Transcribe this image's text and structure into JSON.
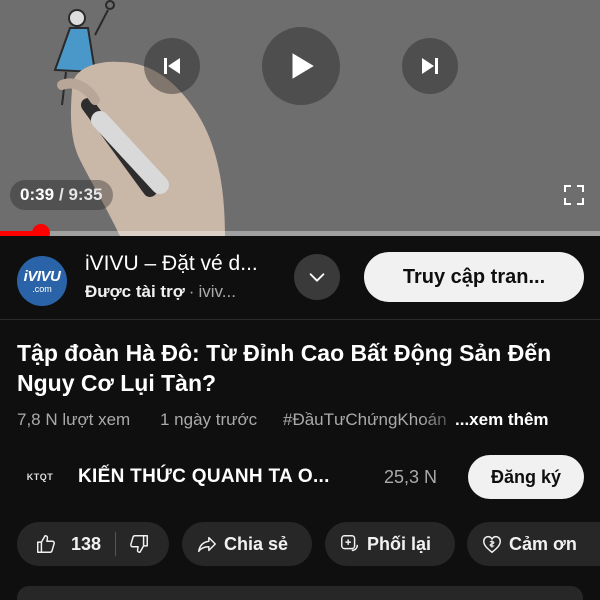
{
  "player": {
    "current_time": "0:39",
    "total_time": "/ 9:35",
    "progress_fraction": 0.068,
    "icons": [
      "previous-icon",
      "play-icon",
      "next-icon",
      "fullscreen-icon"
    ]
  },
  "ad": {
    "logo_line1": "iVIVU",
    "logo_line2": ".com",
    "title": "iVIVU – Đặt vé d...",
    "sponsored": "Được tài trợ",
    "separator": "·",
    "domain": "iviv...",
    "cta": "Truy cập tran..."
  },
  "video": {
    "title": "Tập đoàn Hà Đô: Từ Đỉnh Cao Bất Động Sản Đến Nguy Cơ Lụi Tàn?",
    "views": "7,8 N lượt xem",
    "uploaded": "1 ngày trước",
    "hashtag": "#ĐầuTưChứngKhoán",
    "more": "...xem thêm"
  },
  "channel": {
    "avatar_text": "KTQT",
    "name": "KIẾN THỨC QUANH TA O...",
    "subscribers": "25,3 N",
    "subscribe_label": "Đăng ký"
  },
  "actions": {
    "like_count": "138",
    "share_label": "Chia sẻ",
    "remix_label": "Phối lại",
    "thanks_label": "Cảm ơn"
  },
  "colors": {
    "background": "#0f0f0f",
    "pill": "#272727",
    "progress": "#ff0000",
    "ad_logo": "#2b63a8"
  }
}
